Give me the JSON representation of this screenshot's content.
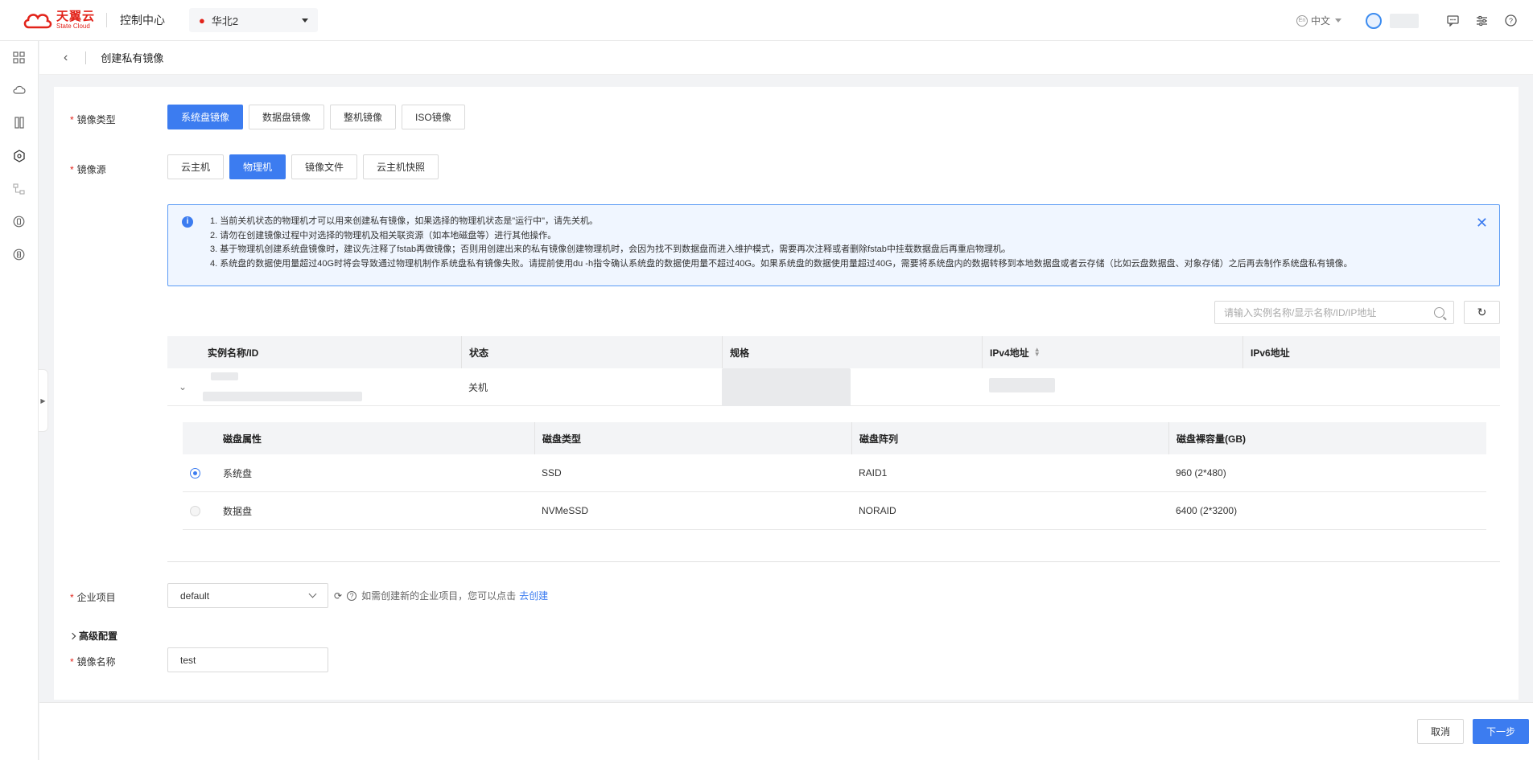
{
  "header": {
    "logo_cn": "天翼云",
    "logo_en": "State Cloud",
    "console_title": "控制中心",
    "region": "华北2",
    "language": "中文",
    "lang_badge": "En"
  },
  "page": {
    "title": "创建私有镜像"
  },
  "form": {
    "image_type": {
      "label": "镜像类型",
      "options": [
        "系统盘镜像",
        "数据盘镜像",
        "整机镜像",
        "ISO镜像"
      ],
      "selected": "系统盘镜像"
    },
    "image_source": {
      "label": "镜像源",
      "options": [
        "云主机",
        "物理机",
        "镜像文件",
        "云主机快照"
      ],
      "selected": "物理机"
    },
    "notice": {
      "icon": "info-icon",
      "lines": [
        "1. 当前关机状态的物理机才可以用来创建私有镜像，如果选择的物理机状态是\"运行中\"，请先关机。",
        "2. 请勿在创建镜像过程中对选择的物理机及相关联资源（如本地磁盘等）进行其他操作。",
        "3. 基于物理机创建系统盘镜像时，建议先注释了fstab再做镜像；否则用创建出来的私有镜像创建物理机时，会因为找不到数据盘而进入维护模式，需要再次注释或者删除fstab中挂载数据盘后再重启物理机。",
        "4. 系统盘的数据使用量超过40G时将会导致通过物理机制作系统盘私有镜像失败。请提前使用du -h指令确认系统盘的数据使用量不超过40G。如果系统盘的数据使用量超过40G，需要将系统盘内的数据转移到本地数据盘或者云存储（比如云盘数据盘、对象存储）之后再去制作系统盘私有镜像。"
      ]
    },
    "search": {
      "placeholder": "请输入实例名称/显示名称/ID/IP地址"
    },
    "instance_table": {
      "columns": [
        "实例名称/ID",
        "状态",
        "规格",
        "IPv4地址",
        "IPv6地址"
      ],
      "rows": [
        {
          "status": "关机"
        }
      ]
    },
    "disk_table": {
      "columns": [
        "磁盘属性",
        "磁盘类型",
        "磁盘阵列",
        "磁盘裸容量(GB)"
      ],
      "rows": [
        {
          "attr": "系统盘",
          "type": "SSD",
          "raid": "RAID1",
          "capacity": "960 (2*480)",
          "selected": true
        },
        {
          "attr": "数据盘",
          "type": "NVMeSSD",
          "raid": "NORAID",
          "capacity": "6400 (2*3200)",
          "selected": false
        }
      ]
    },
    "project": {
      "label": "企业项目",
      "value": "default",
      "hint": "如需创建新的企业项目，您可以点击",
      "link": "去创建"
    },
    "advanced": {
      "label": "高级配置"
    },
    "image_name": {
      "label": "镜像名称",
      "value": "test"
    }
  },
  "footer": {
    "cancel": "取消",
    "next": "下一步"
  },
  "colors": {
    "primary": "#3c7cf0",
    "brand": "#e2231a",
    "required": "#e2231a"
  }
}
